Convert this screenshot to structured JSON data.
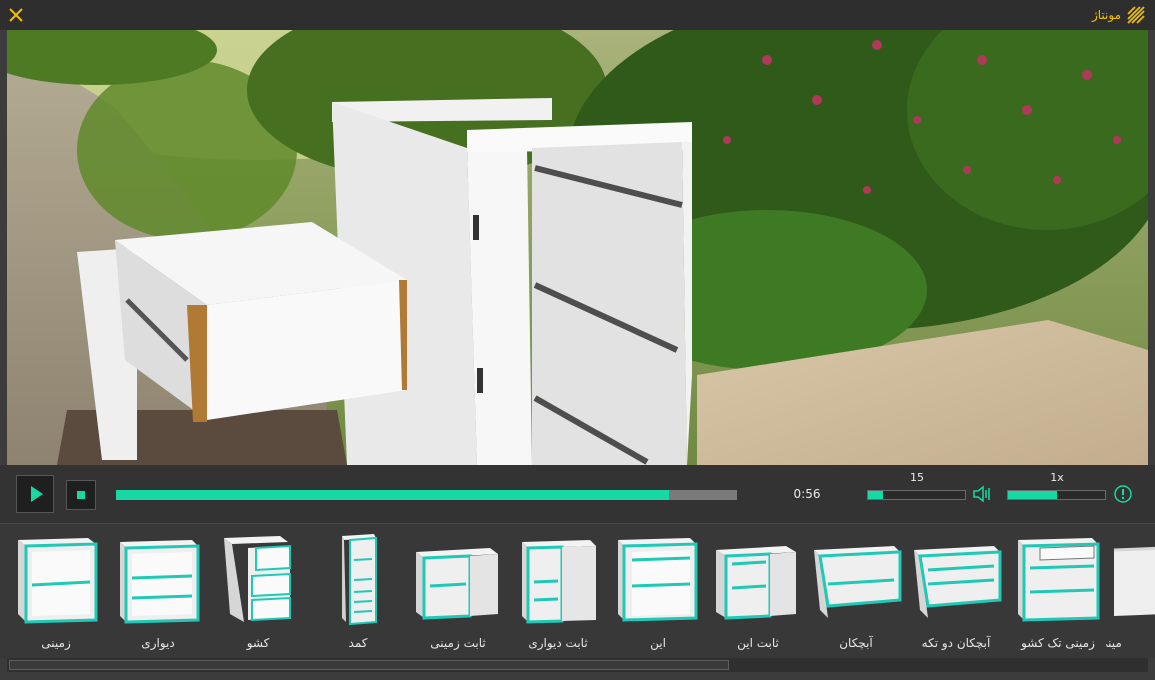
{
  "window": {
    "title": "مونتاژ",
    "colors": {
      "accent": "#f0c000",
      "progress": "#16d9a3"
    }
  },
  "player": {
    "time": "0:56",
    "progress": 0.89,
    "volume": {
      "value": "15",
      "level": 0.15
    },
    "speed": {
      "value": "1x",
      "level": 0.5
    }
  },
  "thumbnails": [
    {
      "label": "زمینی",
      "type": "base"
    },
    {
      "label": "دیواری",
      "type": "wall"
    },
    {
      "label": "کشو",
      "type": "drawers"
    },
    {
      "label": "کمد",
      "type": "tall"
    },
    {
      "label": "ثابت زمینی",
      "type": "corner-base"
    },
    {
      "label": "ثابت دیواری",
      "type": "corner-wall"
    },
    {
      "label": "این",
      "type": "open-base"
    },
    {
      "label": "ثابت این",
      "type": "corner-open"
    },
    {
      "label": "آبچکان",
      "type": "rack"
    },
    {
      "label": "آبچکان دو تکه",
      "type": "rack-two"
    },
    {
      "label": "زمینی تک کشو",
      "type": "base-drawer"
    },
    {
      "label": "مینی",
      "type": "partial"
    }
  ]
}
